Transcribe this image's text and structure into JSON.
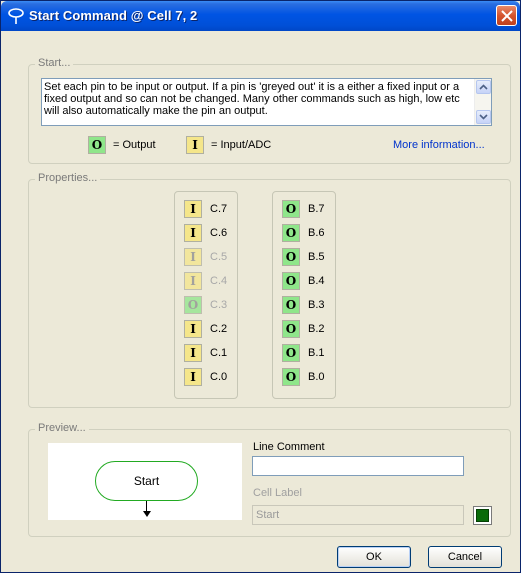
{
  "window": {
    "title": "Start Command @ Cell 7, 2"
  },
  "start_group": {
    "legend": "Start...",
    "description": "Set each pin to be input or output. If a pin is 'greyed out' it is a either a fixed input or a fixed output and so can not be changed. Many other commands such as high, low etc will also automatically make the pin an output.",
    "output_symbol": "O",
    "output_label": "= Output",
    "input_symbol": "I",
    "input_label": "= Input/ADC",
    "more_info": "More information..."
  },
  "properties_group": {
    "legend": "Properties...",
    "c_pins": [
      {
        "mode": "I",
        "label": "C.7",
        "enabled": true
      },
      {
        "mode": "I",
        "label": "C.6",
        "enabled": true
      },
      {
        "mode": "I",
        "label": "C.5",
        "enabled": false
      },
      {
        "mode": "I",
        "label": "C.4",
        "enabled": false
      },
      {
        "mode": "O",
        "label": "C.3",
        "enabled": false
      },
      {
        "mode": "I",
        "label": "C.2",
        "enabled": true
      },
      {
        "mode": "I",
        "label": "C.1",
        "enabled": true
      },
      {
        "mode": "I",
        "label": "C.0",
        "enabled": true
      }
    ],
    "b_pins": [
      {
        "mode": "O",
        "label": "B.7",
        "enabled": true
      },
      {
        "mode": "O",
        "label": "B.6",
        "enabled": true
      },
      {
        "mode": "O",
        "label": "B.5",
        "enabled": true
      },
      {
        "mode": "O",
        "label": "B.4",
        "enabled": true
      },
      {
        "mode": "O",
        "label": "B.3",
        "enabled": true
      },
      {
        "mode": "O",
        "label": "B.2",
        "enabled": true
      },
      {
        "mode": "O",
        "label": "B.1",
        "enabled": true
      },
      {
        "mode": "O",
        "label": "B.0",
        "enabled": true
      }
    ]
  },
  "preview_group": {
    "legend": "Preview...",
    "node_label": "Start",
    "line_comment_label": "Line Comment",
    "line_comment_value": "",
    "cell_label_label": "Cell Label",
    "cell_label_value": "Start",
    "cell_color": "#0a6b0a"
  },
  "buttons": {
    "ok": "OK",
    "cancel": "Cancel"
  },
  "colors": {
    "output_fill": "#8fe68a",
    "input_fill": "#f5e68a",
    "titlebar": "#0054e3"
  }
}
